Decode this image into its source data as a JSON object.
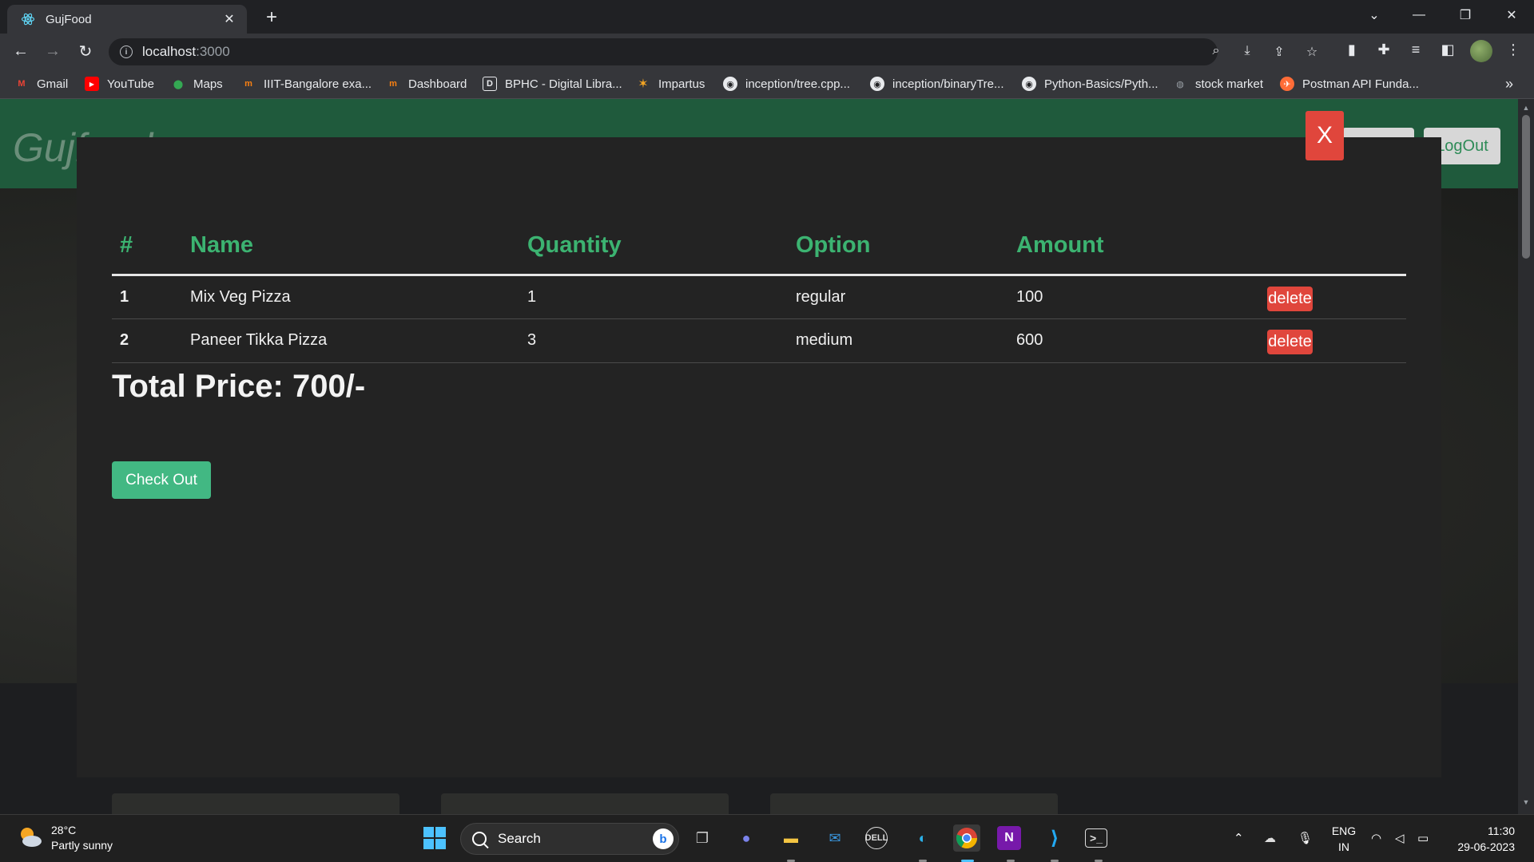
{
  "browser": {
    "tab_title": "GujFood",
    "url_host": "localhost",
    "url_port": ":3000"
  },
  "bookmarks": [
    {
      "label": "Gmail",
      "icon": "gmail-icon",
      "color": "#ea4335"
    },
    {
      "label": "YouTube",
      "icon": "youtube-icon",
      "color": "#ff0000"
    },
    {
      "label": "Maps",
      "icon": "maps-icon",
      "color": "#34a853"
    },
    {
      "label": "IIIT-Bangalore exa...",
      "icon": "moodle-icon",
      "color": "#f98012"
    },
    {
      "label": "Dashboard",
      "icon": "moodle-icon",
      "color": "#f98012"
    },
    {
      "label": "BPHC - Digital Libra...",
      "icon": "library-icon",
      "color": "#e8eaed"
    },
    {
      "label": "Impartus",
      "icon": "impartus-icon",
      "color": "#f5a623"
    },
    {
      "label": "inception/tree.cpp...",
      "icon": "github-icon",
      "color": "#e8eaed"
    },
    {
      "label": "inception/binaryTre...",
      "icon": "github-icon",
      "color": "#e8eaed"
    },
    {
      "label": "Python-Basics/Pyth...",
      "icon": "github-icon",
      "color": "#e8eaed"
    },
    {
      "label": "stock market",
      "icon": "globe-icon",
      "color": "#9aa0a6"
    },
    {
      "label": "Postman API Funda...",
      "icon": "postman-icon",
      "color": "#ff6c37"
    }
  ],
  "site": {
    "brand": "Gujfood",
    "logout_label": "LogOut"
  },
  "cart": {
    "headers": [
      "#",
      "Name",
      "Quantity",
      "Option",
      "Amount",
      ""
    ],
    "rows": [
      {
        "index": "1",
        "name": "Mix Veg Pizza",
        "quantity": "1",
        "option": "regular",
        "amount": "100",
        "action": "delete"
      },
      {
        "index": "2",
        "name": "Paneer Tikka Pizza",
        "quantity": "3",
        "option": "medium",
        "amount": "600",
        "action": "delete"
      }
    ],
    "total": "Total Price: 700/-",
    "checkout_label": "Check Out",
    "close_label": "X"
  },
  "taskbar": {
    "temperature": "28°C",
    "weather": "Partly sunny",
    "search_placeholder": "Search",
    "lang_top": "ENG",
    "lang_bottom": "IN",
    "time": "11:30",
    "date": "29-06-2023"
  },
  "colors": {
    "accent_green": "#3cb371",
    "delete_red": "#e0463c",
    "checkout_green": "#42b883",
    "nav_green": "#1f5a3c"
  }
}
